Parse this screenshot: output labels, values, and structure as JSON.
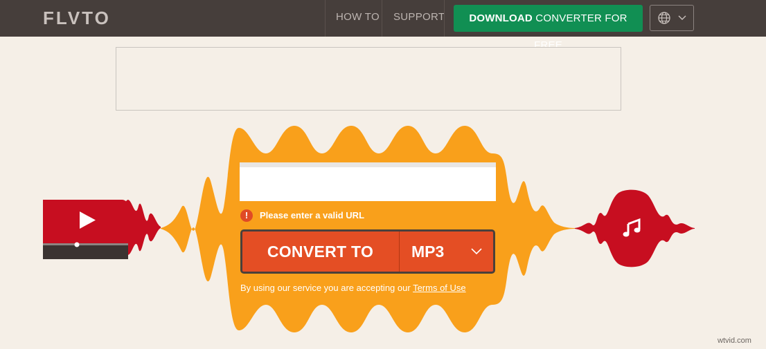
{
  "header": {
    "logo": "FLVTO",
    "nav": [
      {
        "label": "HOW TO"
      },
      {
        "label": "SUPPORT"
      }
    ],
    "download_bold": "DOWNLOAD",
    "download_rest": " CONVERTER FOR FREE",
    "language_icon": "globe-icon"
  },
  "converter": {
    "url_value": "",
    "error": "Please enter a valid URL",
    "convert_label": "CONVERT TO",
    "format_selected": "MP3",
    "terms_text": "By using our service you are accepting our ",
    "terms_link": "Terms of Use"
  },
  "colors": {
    "header_bg": "#463e3b",
    "page_bg": "#f5efe7",
    "wave_orange": "#f9a01b",
    "button_red": "#e44e24",
    "download_green": "#118f53",
    "youtube_red": "#c70e20"
  },
  "watermark": "wtvid.com"
}
